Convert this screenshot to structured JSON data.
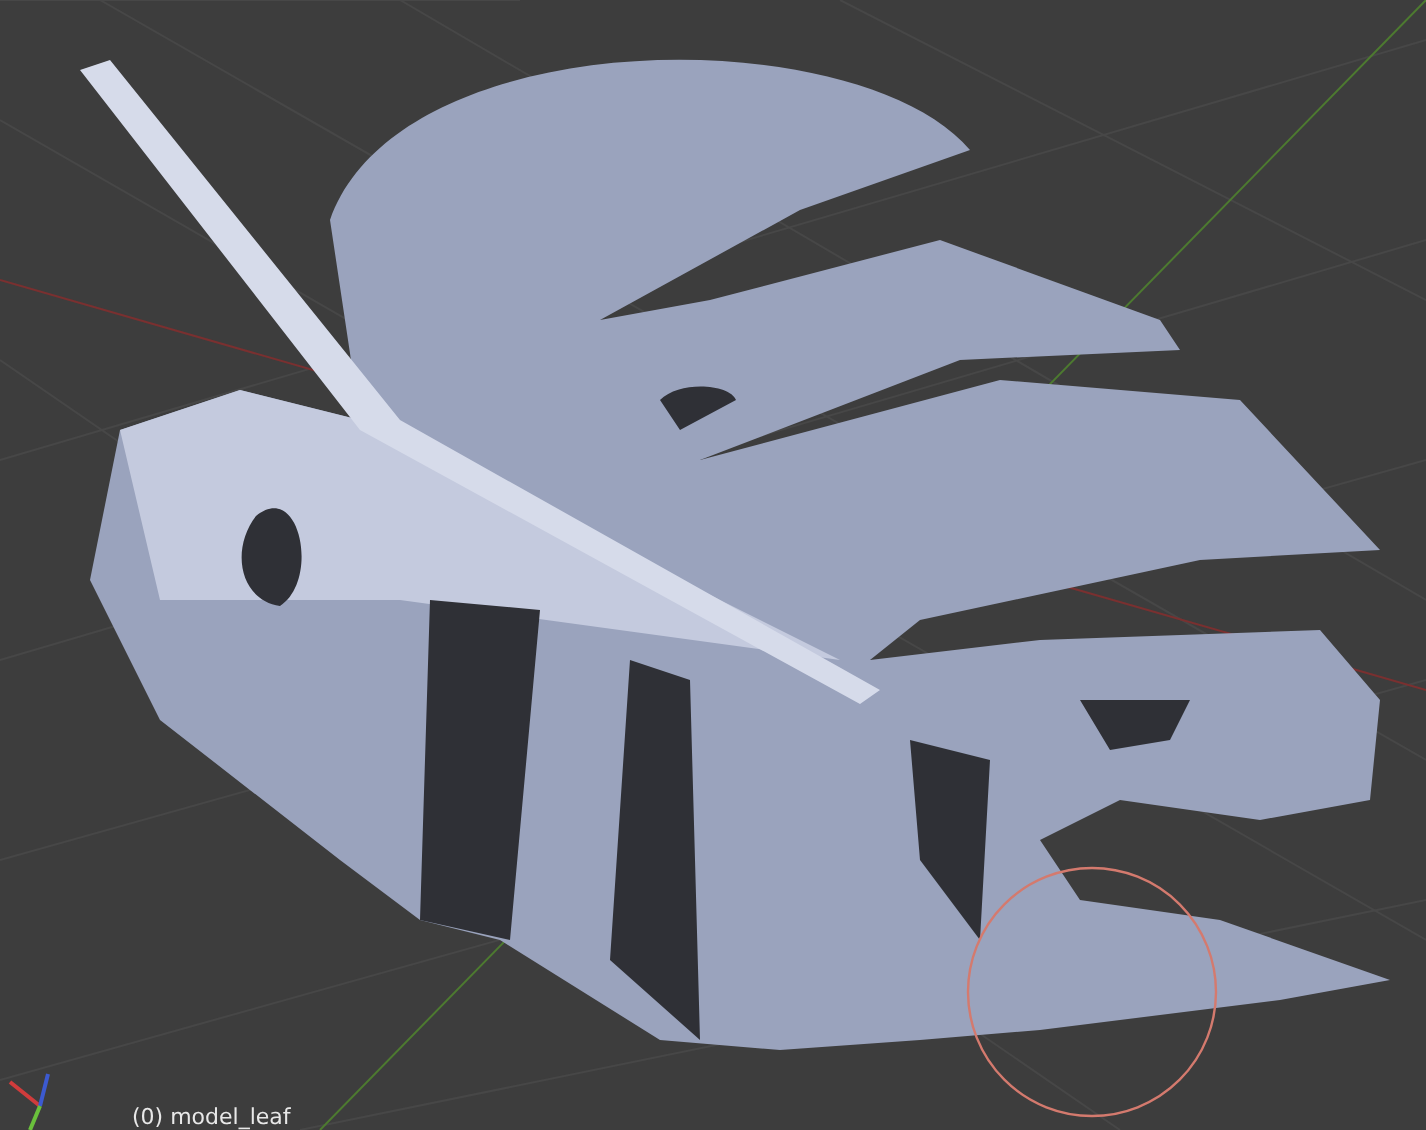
{
  "viewport": {
    "object_label": "(0) model_leaf"
  }
}
